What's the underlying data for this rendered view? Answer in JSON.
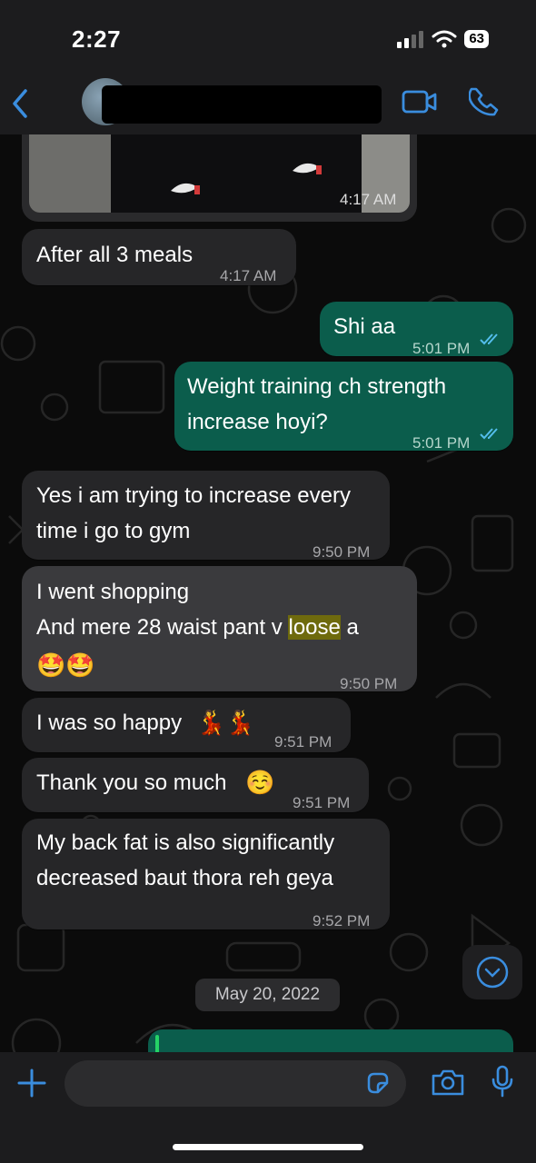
{
  "status_bar": {
    "time": "2:27",
    "battery": "63"
  },
  "photo_message": {
    "time": "4:17 AM"
  },
  "messages": [
    {
      "dir": "in",
      "text": "After all 3 meals",
      "time": "4:17 AM"
    },
    {
      "dir": "out",
      "text": "Shi aa",
      "time": "5:01 PM"
    },
    {
      "dir": "out",
      "text": "Weight training ch strength\nincrease hoyi?",
      "time": "5:01 PM"
    },
    {
      "dir": "in",
      "text": "Yes i am trying to increase every\ntime i go to gym",
      "time": "9:50 PM"
    },
    {
      "dir": "in",
      "line1": "I went shopping",
      "line2_before": "And mere 28 waist pant v ",
      "highlight": "loose",
      "line2_after": " a",
      "emojis": "🤩🤩",
      "time": "9:50 PM"
    },
    {
      "dir": "in",
      "text": "I was so happy",
      "emojis": "💃💃",
      "time": "9:51 PM"
    },
    {
      "dir": "in",
      "text": "Thank you so much",
      "emojis": "☺️",
      "time": "9:51 PM"
    },
    {
      "dir": "in",
      "text": "My back fat is also significantly\ndecreased baut thora reh geya",
      "time": "9:52 PM"
    }
  ],
  "date_separator": "May 20, 2022",
  "colors": {
    "accent": "#3a8dde",
    "outgoing": "#0b5d4c",
    "incoming": "#262628",
    "highlight": "#6e6a0d"
  },
  "icons": [
    "back-icon",
    "video-call-icon",
    "phone-icon",
    "chevron-down-icon",
    "plus-icon",
    "sticker-icon",
    "camera-icon",
    "microphone-icon",
    "read-ticks-icon"
  ]
}
